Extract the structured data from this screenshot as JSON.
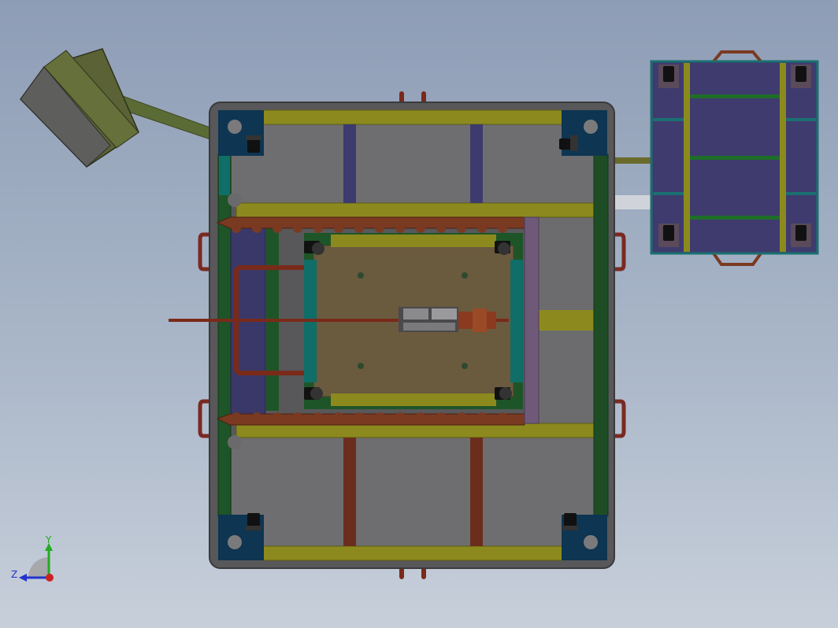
{
  "viewport": {
    "background_top": "#8e9db6",
    "background_bottom": "#c7cfda"
  },
  "triad": {
    "y_label": "Y",
    "z_label": "Z",
    "y_color": "#22aa22",
    "z_color": "#2233cc",
    "x_color": "#cc2222"
  },
  "colors": {
    "frame_gray": "#58585a",
    "panel_gray": "#6e6e70",
    "corner_block": "#0e3552",
    "olive_rail": "#8c8a1e",
    "dark_green": "#1e4d25",
    "teal": "#0f6e67",
    "purple": "#3d3a6d",
    "rust": "#7a2f1a",
    "tray_brown": "#6a5a3e",
    "cart_purple": "#3f3b6e",
    "cart_teal": "#1a7070"
  },
  "icons": [
    "caster-wheel-icon",
    "coordinate-triad-icon"
  ]
}
